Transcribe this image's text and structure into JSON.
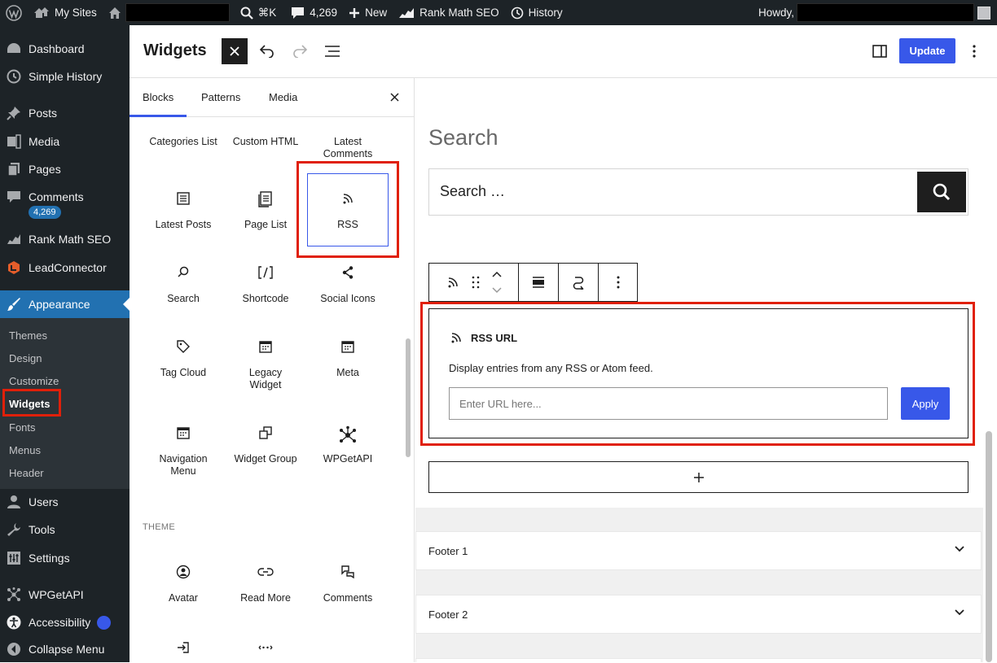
{
  "admin_bar": {
    "my_sites": "My Sites",
    "shortcut": "⌘K",
    "comments_count": "4,269",
    "new": "New",
    "rank_math": "Rank Math SEO",
    "history": "History",
    "howdy": "Howdy,"
  },
  "sidebar": {
    "items": [
      {
        "label": "Dashboard",
        "icon": "dashboard-icon"
      },
      {
        "label": "Simple History",
        "icon": "history-icon"
      },
      {
        "label": "Posts",
        "icon": "pin-icon"
      },
      {
        "label": "Media",
        "icon": "media-icon"
      },
      {
        "label": "Pages",
        "icon": "pages-icon"
      },
      {
        "label": "Comments",
        "icon": "comment-icon"
      },
      {
        "label": "Rank Math SEO",
        "icon": "rank-math-icon"
      },
      {
        "label": "LeadConnector",
        "icon": "leadconnector-icon"
      },
      {
        "label": "Appearance",
        "icon": "brush-icon"
      },
      {
        "label": "Users",
        "icon": "users-icon"
      },
      {
        "label": "Tools",
        "icon": "wrench-icon"
      },
      {
        "label": "Settings",
        "icon": "settings-icon"
      },
      {
        "label": "WPGetAPI",
        "icon": "api-icon"
      },
      {
        "label": "Accessibility",
        "icon": "accessibility-icon"
      },
      {
        "label": "Collapse Menu",
        "icon": "collapse-icon"
      }
    ],
    "comments_badge": "4,269",
    "submenu": [
      "Themes",
      "Design",
      "Customize",
      "Widgets",
      "Fonts",
      "Menus",
      "Header"
    ]
  },
  "header": {
    "title": "Widgets",
    "update": "Update"
  },
  "inserter": {
    "tabs": [
      "Blocks",
      "Patterns",
      "Media"
    ],
    "blocks": [
      {
        "label": "Categories List",
        "icon": "categories-icon"
      },
      {
        "label": "Custom HTML",
        "icon": "html-icon"
      },
      {
        "label": "Latest Comments",
        "icon": "comments-icon"
      },
      {
        "label": "Latest Posts",
        "icon": "list-icon"
      },
      {
        "label": "Page List",
        "icon": "page-list-icon"
      },
      {
        "label": "RSS",
        "icon": "rss-icon"
      },
      {
        "label": "Search",
        "icon": "search-icon"
      },
      {
        "label": "Shortcode",
        "icon": "shortcode-icon"
      },
      {
        "label": "Social Icons",
        "icon": "share-icon"
      },
      {
        "label": "Tag Cloud",
        "icon": "tag-icon"
      },
      {
        "label": "Legacy Widget",
        "icon": "calendar-icon"
      },
      {
        "label": "Meta",
        "icon": "calendar-icon"
      },
      {
        "label": "Navigation Menu",
        "icon": "calendar-icon"
      },
      {
        "label": "Widget Group",
        "icon": "group-icon"
      },
      {
        "label": "WPGetAPI",
        "icon": "api-icon"
      }
    ],
    "theme_label": "THEME",
    "theme_blocks": [
      {
        "label": "Avatar",
        "icon": "avatar-icon"
      },
      {
        "label": "Read More",
        "icon": "link-icon"
      },
      {
        "label": "Comments",
        "icon": "comments-icon"
      },
      {
        "label": "",
        "icon": "login-icon"
      },
      {
        "label": "",
        "icon": "more-icon"
      }
    ]
  },
  "canvas": {
    "search_title": "Search",
    "search_placeholder": "Search …",
    "rss": {
      "label": "RSS URL",
      "description": "Display entries from any RSS or Atom feed.",
      "input_placeholder": "Enter URL here...",
      "apply": "Apply"
    },
    "footers": [
      "Footer 1",
      "Footer 2"
    ]
  },
  "colors": {
    "accent": "#3858e9",
    "admin_blue": "#2271b1",
    "highlight_red": "#e0200a"
  }
}
